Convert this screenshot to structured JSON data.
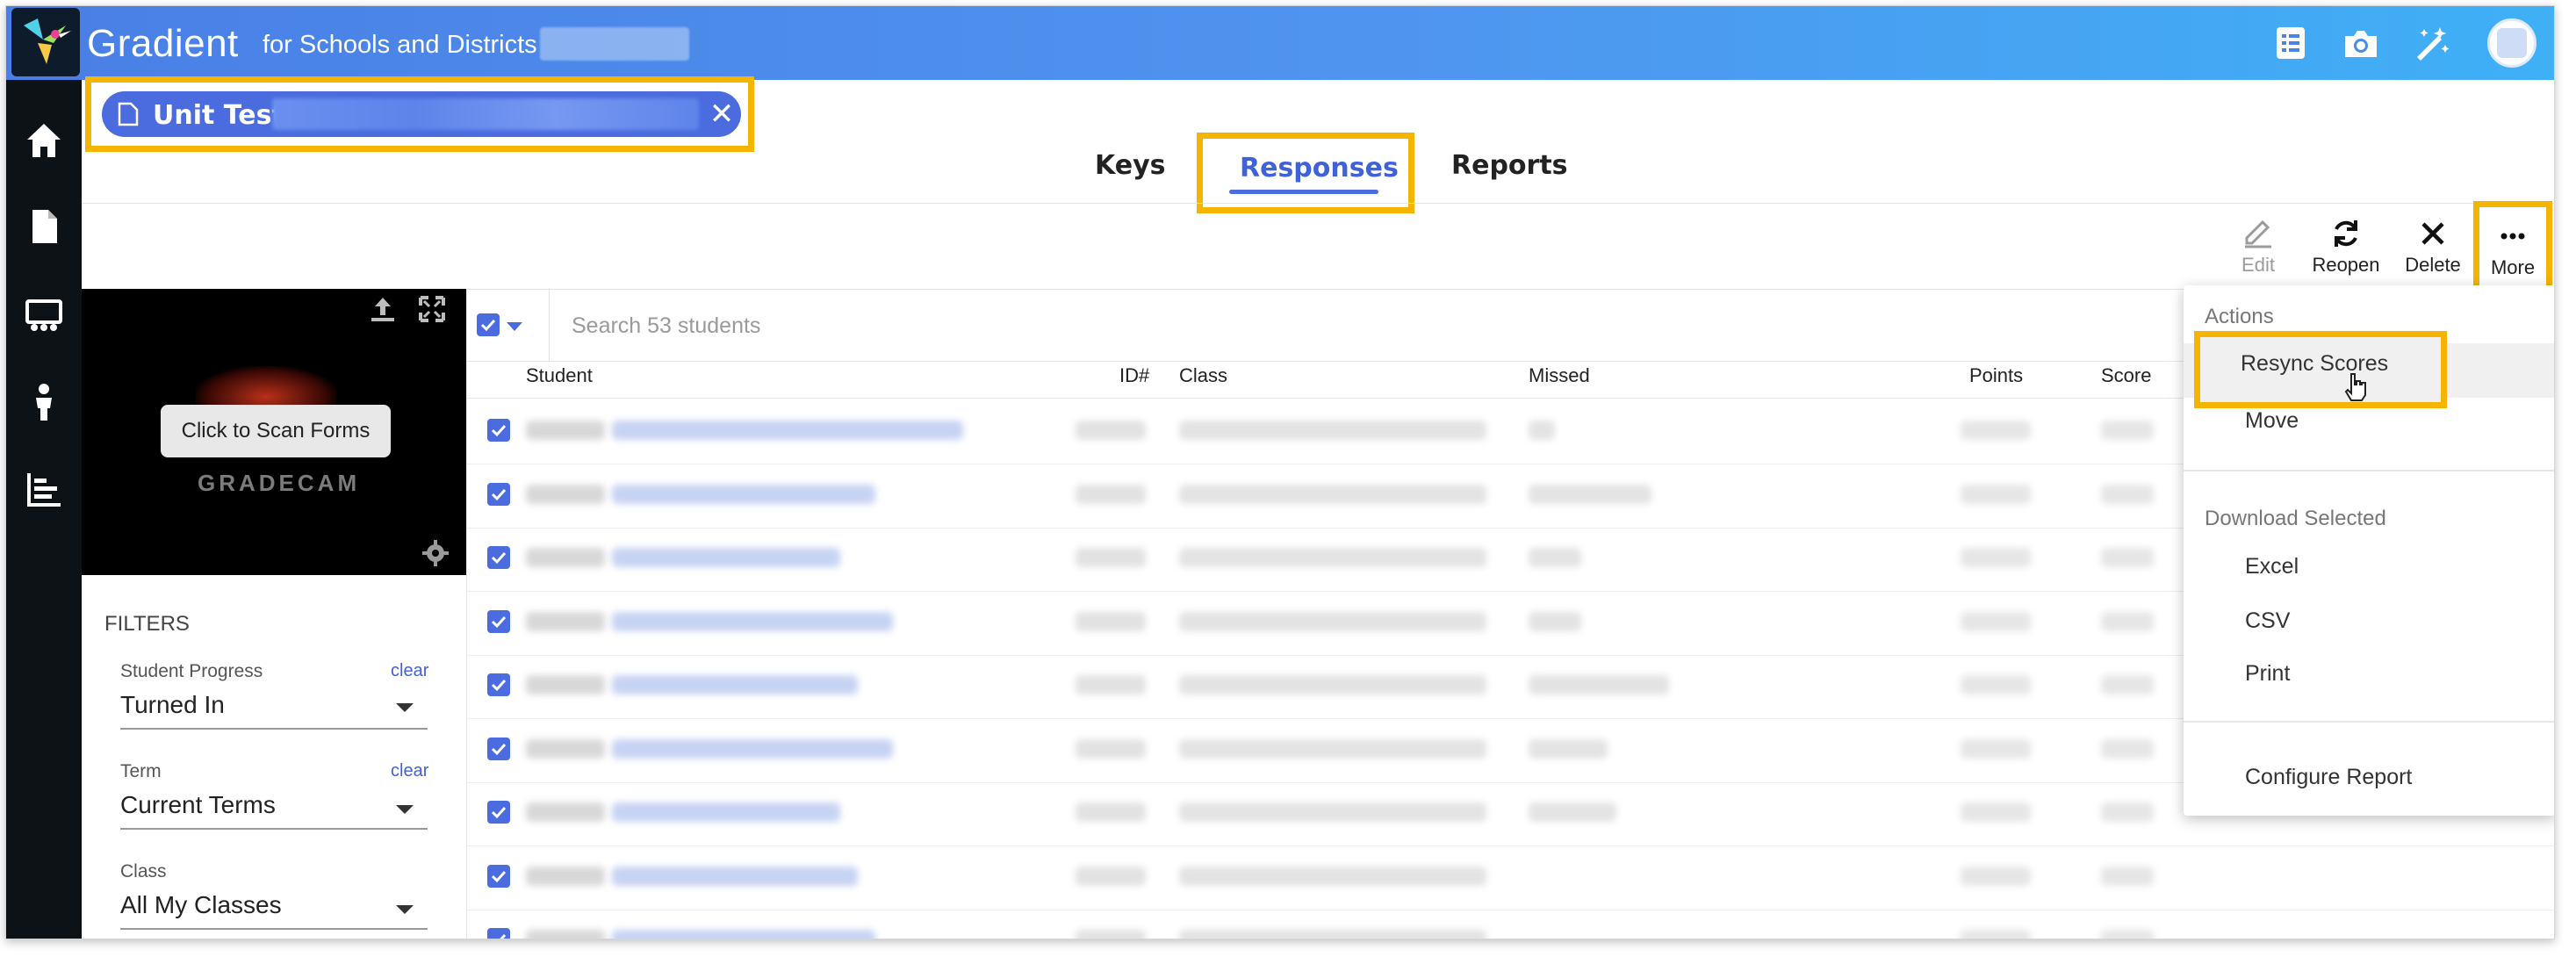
{
  "app": {
    "name": "Gradient",
    "subtitle": "for Schools and Districts"
  },
  "topbar_icons": [
    "list-icon",
    "camera-icon",
    "magic-wand-icon",
    "avatar"
  ],
  "rail_icons": [
    "home-icon",
    "document-icon",
    "classroom-icon",
    "student-icon",
    "chart-icon"
  ],
  "test_chip": {
    "label": "Unit Test"
  },
  "tabs": [
    {
      "label": "Keys"
    },
    {
      "label": "Responses",
      "active": true
    },
    {
      "label": "Reports"
    }
  ],
  "toolbar": {
    "edit": "Edit",
    "reopen": "Reopen",
    "delete": "Delete",
    "more": "More"
  },
  "scan": {
    "button": "Click to Scan Forms",
    "brand": "GRADECAM"
  },
  "filters": {
    "title": "FILTERS",
    "student_progress": {
      "label": "Student Progress",
      "clear": "clear",
      "value": "Turned In"
    },
    "term": {
      "label": "Term",
      "clear": "clear",
      "value": "Current Terms"
    },
    "class": {
      "label": "Class",
      "value": "All My Classes"
    }
  },
  "search": {
    "placeholder": "Search 53 students"
  },
  "table": {
    "headers": {
      "student": "Student",
      "id": "ID#",
      "class": "Class",
      "missed": "Missed",
      "points": "Points",
      "score": "Score"
    },
    "row_count_visible": 9
  },
  "menu": {
    "actions_header": "Actions",
    "resync": "Resync Scores",
    "move": "Move",
    "download_header": "Download Selected",
    "excel": "Excel",
    "csv": "CSV",
    "print": "Print",
    "configure": "Configure Report"
  },
  "colors": {
    "accent": "#4a6cde",
    "highlight": "#f5b400",
    "rail": "#0d1217"
  }
}
